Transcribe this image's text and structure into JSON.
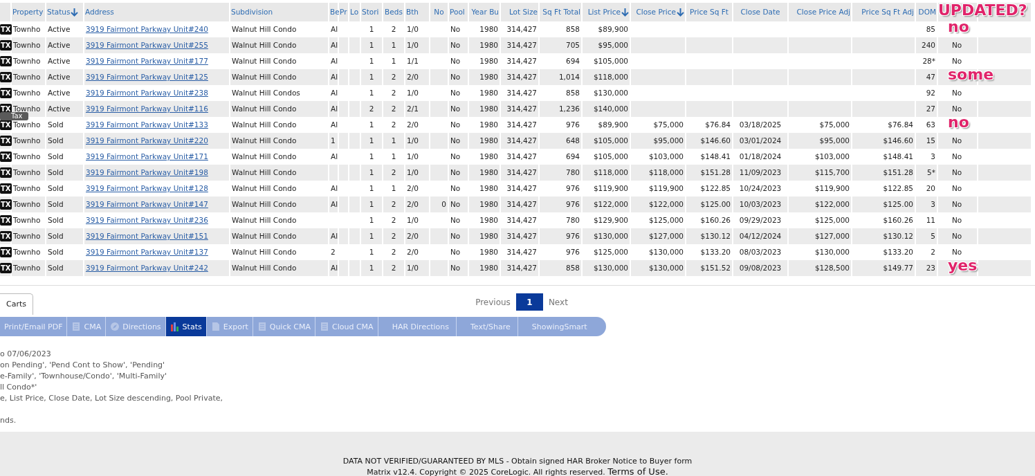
{
  "table": {
    "header_note": "UPDATED?",
    "columns": [
      {
        "title": "Property",
        "sorted": false
      },
      {
        "title": "Status",
        "sorted": true
      },
      {
        "title": "Address",
        "sorted": false
      },
      {
        "title": "Subdivision",
        "sorted": false
      },
      {
        "title": "Be",
        "sorted": false
      },
      {
        "title": "Pr",
        "sorted": false
      },
      {
        "title": "Lo",
        "sorted": false
      },
      {
        "title": "Stori",
        "sorted": false
      },
      {
        "title": "Beds",
        "sorted": false
      },
      {
        "title": "Bth",
        "sorted": false
      },
      {
        "title": "No",
        "sorted": false
      },
      {
        "title": "Pool",
        "sorted": false
      },
      {
        "title": "Year Bu",
        "sorted": false
      },
      {
        "title": "Lot Size",
        "sorted": false
      },
      {
        "title": "Sq Ft Total",
        "sorted": false
      },
      {
        "title": "List Price",
        "sorted": true
      },
      {
        "title": "Close Price",
        "sorted": true
      },
      {
        "title": "Price Sq Ft",
        "sorted": false
      },
      {
        "title": "Close Date",
        "sorted": false
      },
      {
        "title": "Close Price Adj",
        "sorted": false
      },
      {
        "title": "Price Sq Ft Adj",
        "sorted": false
      },
      {
        "title": "DOM",
        "sorted": false
      },
      {},
      {}
    ],
    "rows": [
      {
        "badge": "TX",
        "note": "no",
        "cells": [
          "Townho",
          "Active",
          "3919 Fairmont Parkway Unit#240",
          "Walnut Hill Condo",
          "Al",
          null,
          null,
          "1",
          "2",
          "1/0",
          null,
          "No",
          "1980",
          "314,427",
          "858",
          "$89,900",
          null,
          null,
          null,
          null,
          null,
          "85",
          null,
          null
        ]
      },
      {
        "badge": "TX",
        "cells": [
          "Townho",
          "Active",
          "3919 Fairmont Parkway Unit#255",
          "Walnut Hill Condo",
          "Al",
          null,
          null,
          "1",
          "1",
          "1/0",
          null,
          "No",
          "1980",
          "314,427",
          "705",
          "$95,000",
          null,
          null,
          null,
          null,
          null,
          "240",
          "No",
          null
        ]
      },
      {
        "badge": "TX",
        "cells": [
          "Townho",
          "Active",
          "3919 Fairmont Parkway Unit#177",
          "Walnut Hill Condo",
          "Al",
          null,
          null,
          "1",
          "1",
          "1/1",
          null,
          "No",
          "1980",
          "314,427",
          "694",
          "$105,000",
          null,
          null,
          null,
          null,
          null,
          "28*",
          "No",
          null
        ]
      },
      {
        "badge": "TX",
        "note": "some",
        "cells": [
          "Townho",
          "Active",
          "3919 Fairmont Parkway Unit#125",
          "Walnut Hill Condo",
          "Al",
          null,
          null,
          "1",
          "2",
          "2/0",
          null,
          "No",
          "1980",
          "314,427",
          "1,014",
          "$118,000",
          null,
          null,
          null,
          null,
          null,
          "47",
          null,
          null
        ]
      },
      {
        "badge": "TX",
        "cells": [
          "Townho",
          "Active",
          "3919 Fairmont Parkway Unit#238",
          "Walnut Hill Condos",
          "Al",
          null,
          null,
          "1",
          "2",
          "1/0",
          null,
          "No",
          "1980",
          "314,427",
          "858",
          "$130,000",
          null,
          null,
          null,
          null,
          null,
          "92",
          "No",
          null
        ]
      },
      {
        "badge": "TX",
        "cells": [
          "Townho",
          "Active",
          "3919 Fairmont Parkway Unit#116",
          "Walnut Hill Condo",
          "Al",
          null,
          null,
          "2",
          "2",
          "2/1",
          null,
          "No",
          "1980",
          "314,427",
          "1,236",
          "$140,000",
          null,
          null,
          null,
          null,
          null,
          "27",
          "No",
          null
        ]
      },
      {
        "badge": "TX",
        "tooltip": "Tax",
        "note": "no",
        "cells": [
          "Townho",
          "Sold",
          "3919 Fairmont Parkway Unit#133",
          "Walnut Hill Condo",
          "Al",
          null,
          null,
          "1",
          "2",
          "2/0",
          null,
          "No",
          "1980",
          "314,427",
          "976",
          "$89,900",
          "$75,000",
          "$76.84",
          "03/18/2025",
          "$75,000",
          "$76.84",
          "63",
          null,
          null
        ]
      },
      {
        "badge": "TX",
        "cells": [
          "Townho",
          "Sold",
          "3919 Fairmont Parkway Unit#220",
          "Walnut Hill Condo",
          "1",
          null,
          null,
          "1",
          "1",
          "1/0",
          null,
          "No",
          "1980",
          "314,427",
          "648",
          "$105,000",
          "$95,000",
          "$146.60",
          "03/01/2024",
          "$95,000",
          "$146.60",
          "15",
          "No",
          null
        ]
      },
      {
        "badge": "TX",
        "cells": [
          "Townho",
          "Sold",
          "3919 Fairmont Parkway Unit#171",
          "Walnut Hill Condo",
          "Al",
          null,
          null,
          "1",
          "1",
          "1/0",
          null,
          "No",
          "1980",
          "314,427",
          "694",
          "$105,000",
          "$103,000",
          "$148.41",
          "01/18/2024",
          "$103,000",
          "$148.41",
          "3",
          "No",
          null
        ]
      },
      {
        "badge": "TX",
        "cells": [
          "Townho",
          "Sold",
          "3919 Fairmont Parkway Unit#198",
          "Walnut Hill Condo",
          null,
          null,
          null,
          "1",
          "2",
          "1/0",
          null,
          "No",
          "1980",
          "314,427",
          "780",
          "$118,000",
          "$118,000",
          "$151.28",
          "11/09/2023",
          "$115,700",
          "$151.28",
          "5*",
          "No",
          null
        ]
      },
      {
        "badge": "TX",
        "cells": [
          "Townho",
          "Sold",
          "3919 Fairmont Parkway Unit#128",
          "Walnut Hill Condo",
          "Al",
          null,
          null,
          "1",
          "1",
          "2/0",
          null,
          "No",
          "1980",
          "314,427",
          "976",
          "$119,900",
          "$119,900",
          "$122.85",
          "10/24/2023",
          "$119,900",
          "$122.85",
          "20",
          "No",
          null
        ]
      },
      {
        "badge": "TX",
        "cells": [
          "Townho",
          "Sold",
          "3919 Fairmont Parkway Unit#147",
          "Walnut Hill Condo",
          "Al",
          null,
          null,
          "1",
          "2",
          "2/0",
          "0",
          "No",
          "1980",
          "314,427",
          "976",
          "$122,000",
          "$122,000",
          "$125.00",
          "10/03/2023",
          "$122,000",
          "$125.00",
          "3",
          "No",
          null
        ]
      },
      {
        "badge": "TX",
        "cells": [
          "Townho",
          "Sold",
          "3919 Fairmont Parkway Unit#236",
          "Walnut Hill Condo",
          null,
          null,
          null,
          "1",
          "2",
          "1/0",
          null,
          "No",
          "1980",
          "314,427",
          "780",
          "$129,900",
          "$125,000",
          "$160.26",
          "09/29/2023",
          "$125,000",
          "$160.26",
          "11",
          "No",
          null
        ]
      },
      {
        "badge": "TX",
        "cells": [
          "Townho",
          "Sold",
          "3919 Fairmont Parkway Unit#151",
          "Walnut Hill Condo",
          "Al",
          null,
          null,
          "1",
          "2",
          "2/0",
          null,
          "No",
          "1980",
          "314,427",
          "976",
          "$130,000",
          "$127,000",
          "$130.12",
          "04/12/2024",
          "$127,000",
          "$130.12",
          "5",
          "No",
          null
        ]
      },
      {
        "badge": "TX",
        "cells": [
          "Townho",
          "Sold",
          "3919 Fairmont Parkway Unit#137",
          "Walnut Hill Condo",
          "2",
          null,
          null,
          "1",
          "2",
          "2/0",
          null,
          "No",
          "1980",
          "314,427",
          "976",
          "$125,000",
          "$130,000",
          "$133.20",
          "08/03/2023",
          "$130,000",
          "$133.20",
          "2",
          "No",
          null
        ]
      },
      {
        "badge": "TX",
        "note": "yes",
        "cells": [
          "Townho",
          "Sold",
          "3919 Fairmont Parkway Unit#242",
          "Walnut Hill Condo",
          "Al",
          null,
          null,
          "1",
          "2",
          "1/0",
          null,
          "No",
          "1980",
          "314,427",
          "858",
          "$130,000",
          "$130,000",
          "$151.52",
          "09/08/2023",
          "$128,500",
          "$149.77",
          "23",
          null,
          null
        ]
      }
    ]
  },
  "tabs": [
    {
      "label": "Carts",
      "selected": true
    }
  ],
  "pagination": {
    "previous": "Previous",
    "next": "Next",
    "pages": [
      {
        "label": "1",
        "selected": true
      }
    ]
  },
  "toolbar": [
    {
      "label": "Print/Email PDF",
      "kind": "none",
      "selected": false
    },
    {
      "label": "CMA",
      "kind": "page",
      "selected": false
    },
    {
      "label": "Directions",
      "kind": "circle",
      "selected": false
    },
    {
      "label": "Stats",
      "kind": "bars",
      "selected": true
    },
    {
      "label": "Export",
      "kind": "export",
      "selected": false
    },
    {
      "label": "Quick CMA",
      "kind": "page",
      "selected": false
    },
    {
      "label": "Cloud CMA",
      "kind": "page",
      "selected": false
    },
    {
      "label": "HAR Directions",
      "kind": "none",
      "selected": false
    },
    {
      "label": "Text/Share",
      "kind": "none",
      "selected": false
    },
    {
      "label": "ShowingSmart",
      "kind": "none",
      "selected": false
    }
  ],
  "criteria": [
    [
      "o 07/06/2023",
      "on Pending', 'Pend Cont to Show', 'Pending'",
      "e-Family', 'Townhouse/Condo', 'Multi-Family'",
      "ll Condo*'",
      "e, List Price, Close Date, Lot Size descending, Pool Private,"
    ],
    [
      "nds."
    ]
  ],
  "footer": {
    "notice": "DATA NOT VERIFIED/GUARANTEED BY MLS - Obtain signed HAR Broker Notice to Buyer form",
    "copyright": "Matrix v12.4. Copyright © 2025 CoreLogic. All rights reserved.",
    "terms_link": "Terms of Use."
  }
}
